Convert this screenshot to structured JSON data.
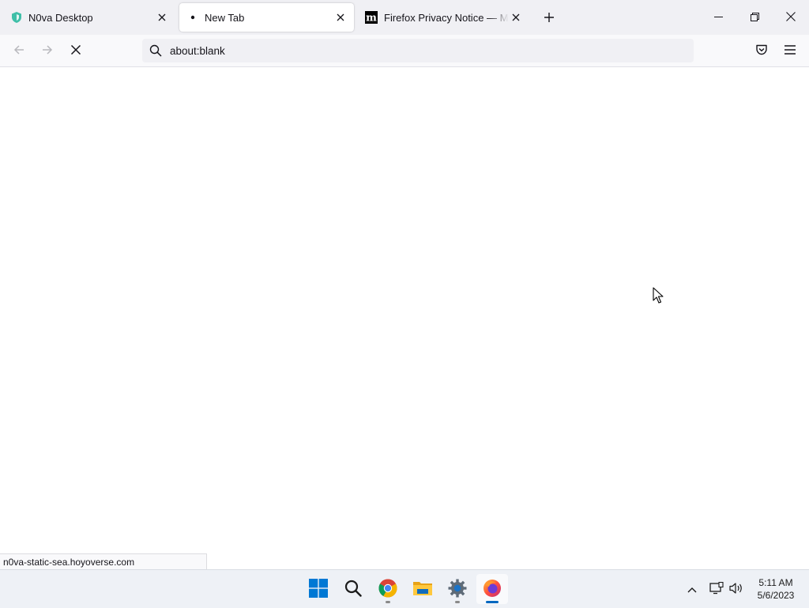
{
  "tabs": [
    {
      "title": "N0va Desktop",
      "favicon": "n0va-shield-icon",
      "selected": false
    },
    {
      "title": "New Tab",
      "favicon": "loading-dot-icon",
      "selected": true
    },
    {
      "title": "Firefox Privacy Notice — Mozilla",
      "favicon": "mozilla-m-icon",
      "selected": false
    }
  ],
  "navigation": {
    "url": "about:blank",
    "back_enabled": false,
    "forward_enabled": false,
    "loading": true
  },
  "status": {
    "text": "n0va-static-sea.hoyoverse.com"
  },
  "taskbar": {
    "apps": [
      "windows-start-icon",
      "search-icon",
      "chrome-icon",
      "file-explorer-icon",
      "settings-icon",
      "firefox-icon"
    ],
    "active_app": "firefox-icon"
  },
  "clock": {
    "time": "5:11 AM",
    "date": "5/6/2023"
  },
  "colors": {
    "tabstrip_bg": "#f0f0f4",
    "toolbar_bg": "#f9f9fb",
    "accent": "#0067c0"
  }
}
